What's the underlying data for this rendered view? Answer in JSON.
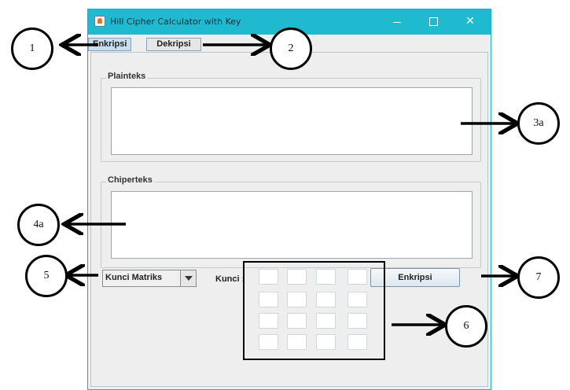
{
  "window": {
    "title": "Hill Cipher Calculator with Key",
    "accent": "#1fbad0"
  },
  "tabs": [
    {
      "label": "Enkripsi",
      "selected": true
    },
    {
      "label": "Dekripsi",
      "selected": false
    }
  ],
  "plaintext_group": {
    "title": "Plainteks",
    "value": ""
  },
  "ciphertext_group": {
    "title": "Chiperteks",
    "value": ""
  },
  "key_mode": {
    "selected": "Kunci Matriks"
  },
  "key_label": "Kunci :",
  "key_matrix": [
    [
      "",
      "",
      "",
      ""
    ],
    [
      "",
      "",
      "",
      ""
    ],
    [
      "",
      "",
      "",
      ""
    ],
    [
      "",
      "",
      "",
      ""
    ]
  ],
  "action_button": "Enkripsi",
  "annotations": {
    "c1": "1",
    "c2": "2",
    "c3a": "3a",
    "c4a": "4a",
    "c5": "5",
    "c6": "6",
    "c7": "7"
  }
}
